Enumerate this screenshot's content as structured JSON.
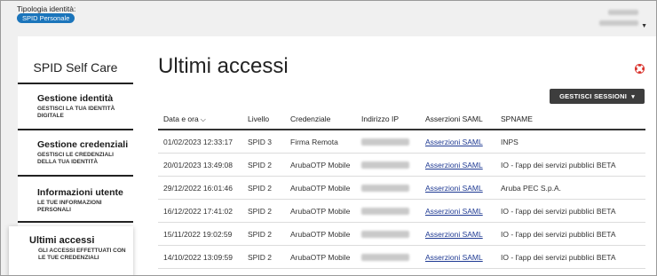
{
  "header": {
    "tipologia_label": "Tipologia identità:",
    "spid_badge": "SPID Personale"
  },
  "sidebar": {
    "title": "SPID Self Care",
    "items": [
      {
        "label": "Gestione identità",
        "desc": "GESTISCI LA TUA IDENTITÀ DIGITALE"
      },
      {
        "label": "Gestione credenziali",
        "desc": "GESTISCI LE CREDENZIALI DELLA TUA IDENTITÀ"
      },
      {
        "label": "Informazioni utente",
        "desc": "LE TUE INFORMAZIONI PERSONALI"
      },
      {
        "label": "Ultimi accessi",
        "desc": "GLI ACCESSI EFFETTUATI CON LE TUE CREDENZIALI"
      }
    ]
  },
  "main": {
    "title": "Ultimi accessi",
    "gestisci_button": "GESTISCI SESSIONI",
    "gestisci_caret": "▾",
    "sort_caret": "⌵",
    "columns": [
      "Data e ora",
      "Livello",
      "Credenziale",
      "Indirizzo IP",
      "Asserzioni SAML",
      "SPNAME"
    ],
    "rows": [
      {
        "date": "01/02/2023 12:33:17",
        "level": "SPID 3",
        "cred": "Firma Remota",
        "saml": "Asserzioni SAML",
        "spname": "INPS"
      },
      {
        "date": "20/01/2023 13:49:08",
        "level": "SPID 2",
        "cred": "ArubaOTP Mobile",
        "saml": "Asserzioni SAML",
        "spname": "IO - l'app dei servizi pubblici BETA"
      },
      {
        "date": "29/12/2022 16:01:46",
        "level": "SPID 2",
        "cred": "ArubaOTP Mobile",
        "saml": "Asserzioni SAML",
        "spname": "Aruba PEC S.p.A."
      },
      {
        "date": "16/12/2022 17:41:02",
        "level": "SPID 2",
        "cred": "ArubaOTP Mobile",
        "saml": "Asserzioni SAML",
        "spname": "IO - l'app dei servizi pubblici BETA"
      },
      {
        "date": "15/11/2022 19:02:59",
        "level": "SPID 2",
        "cred": "ArubaOTP Mobile",
        "saml": "Asserzioni SAML",
        "spname": "IO - l'app dei servizi pubblici BETA"
      },
      {
        "date": "14/10/2022 13:09:59",
        "level": "SPID 2",
        "cred": "ArubaOTP Mobile",
        "saml": "Asserzioni SAML",
        "spname": "IO - l'app dei servizi pubblici BETA"
      }
    ]
  },
  "icons": {
    "help": "help-lifebuoy-icon",
    "user_caret": "chevron-down-icon"
  },
  "colors": {
    "badge": "#1b75bb",
    "button": "#3d3d3d",
    "link": "#1f3a93",
    "help_icon": "#d9312b"
  }
}
